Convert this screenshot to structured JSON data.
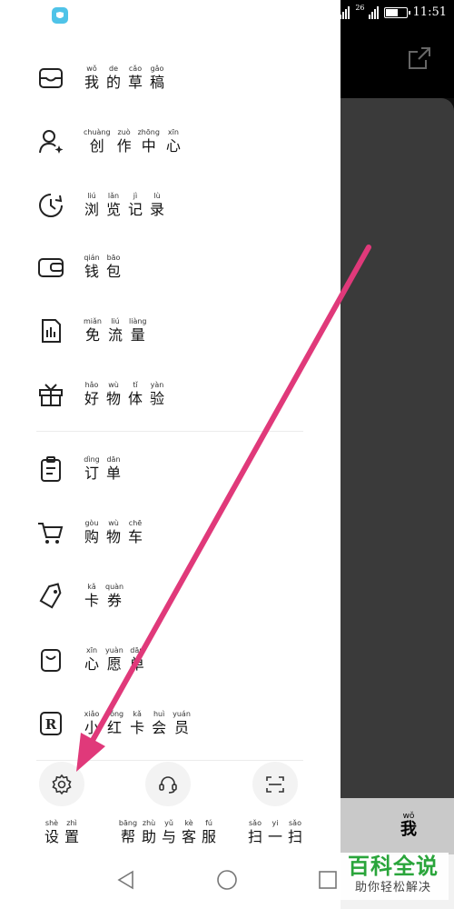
{
  "status_bar": {
    "network": "26",
    "time": "11:51"
  },
  "menu": {
    "items": [
      {
        "icon": "inbox-icon",
        "chars": [
          [
            "wǒ",
            "我"
          ],
          [
            "de",
            "的"
          ],
          [
            "cǎo",
            "草"
          ],
          [
            "gǎo",
            "稿"
          ]
        ]
      },
      {
        "icon": "user-star-icon",
        "chars": [
          [
            "chuàng",
            "创"
          ],
          [
            "zuò",
            "作"
          ],
          [
            "zhōng",
            "中"
          ],
          [
            "xīn",
            "心"
          ]
        ]
      },
      {
        "icon": "history-clock-icon",
        "chars": [
          [
            "liú",
            "浏"
          ],
          [
            "lǎn",
            "览"
          ],
          [
            "jì",
            "记"
          ],
          [
            "lù",
            "录"
          ]
        ]
      },
      {
        "icon": "wallet-icon",
        "chars": [
          [
            "qián",
            "钱"
          ],
          [
            "bāo",
            "包"
          ]
        ]
      },
      {
        "icon": "data-sim-icon",
        "chars": [
          [
            "miǎn",
            "免"
          ],
          [
            "liú",
            "流"
          ],
          [
            "liàng",
            "量"
          ]
        ]
      },
      {
        "icon": "gift-icon",
        "chars": [
          [
            "hǎo",
            "好"
          ],
          [
            "wù",
            "物"
          ],
          [
            "tǐ",
            "体"
          ],
          [
            "yàn",
            "验"
          ]
        ]
      },
      {
        "icon": "order-clipboard-icon",
        "chars": [
          [
            "dìng",
            "订"
          ],
          [
            "dān",
            "单"
          ]
        ]
      },
      {
        "icon": "cart-icon",
        "chars": [
          [
            "gòu",
            "购"
          ],
          [
            "wù",
            "物"
          ],
          [
            "chē",
            "车"
          ]
        ]
      },
      {
        "icon": "coupon-tag-icon",
        "chars": [
          [
            "kǎ",
            "卡"
          ],
          [
            "quàn",
            "券"
          ]
        ]
      },
      {
        "icon": "wishlist-bag-icon",
        "chars": [
          [
            "xīn",
            "心"
          ],
          [
            "yuàn",
            "愿"
          ],
          [
            "dān",
            "单"
          ]
        ]
      },
      {
        "icon": "r-member-icon",
        "chars": [
          [
            "xiǎo",
            "小"
          ],
          [
            "hóng",
            "红"
          ],
          [
            "kǎ",
            "卡"
          ],
          [
            "huì",
            "会"
          ],
          [
            "yuán",
            "员"
          ]
        ]
      }
    ]
  },
  "bottom_actions": [
    {
      "icon": "settings-gear-icon",
      "chars": [
        [
          "shè",
          "设"
        ],
        [
          "zhì",
          "置"
        ]
      ]
    },
    {
      "icon": "headset-support-icon",
      "chars": [
        [
          "bāng",
          "帮"
        ],
        [
          "zhù",
          "助"
        ],
        [
          "yǔ",
          "与"
        ],
        [
          "kè",
          "客"
        ],
        [
          "fú",
          "服"
        ]
      ]
    },
    {
      "icon": "scan-icon",
      "chars": [
        [
          "sǎo",
          "扫"
        ],
        [
          "yi",
          "一"
        ],
        [
          "sǎo",
          "扫"
        ]
      ]
    }
  ],
  "background_tab": {
    "pinyin": "wǒ",
    "label": "我"
  },
  "watermark": {
    "title": "百科全说",
    "subtitle": "助你轻松解决"
  },
  "colors": {
    "arrow": "#e0397a",
    "watermark_green": "#2aa53b",
    "drawer_bg": "#ffffff"
  },
  "battery_level": 0.6
}
